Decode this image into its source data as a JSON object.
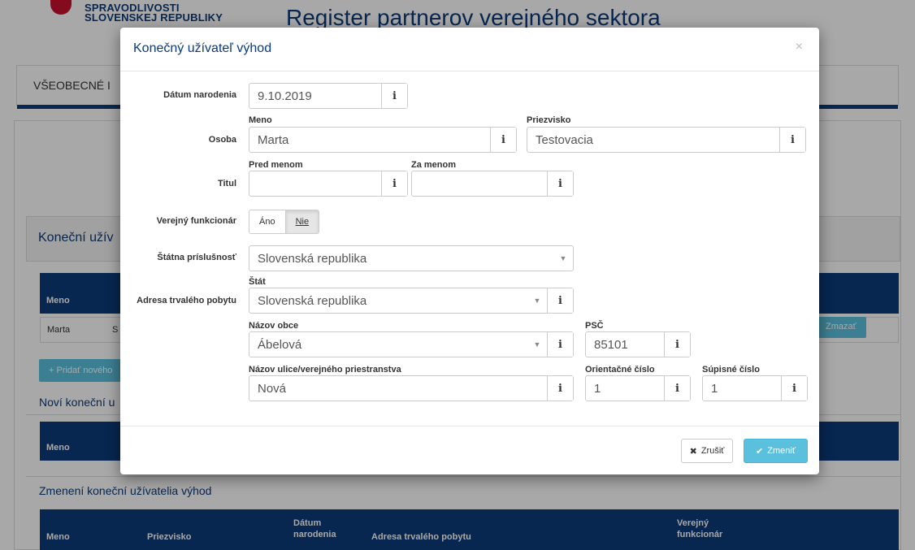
{
  "header": {
    "logo_line1": "SPRAVODLIVOSTI",
    "logo_line2": "SLOVENSKEJ REPUBLIKY",
    "site_title": "Register partnerov verejného sektora"
  },
  "nav": {
    "item": "VŠEOBECNÉ I"
  },
  "background": {
    "panel_title": "Koneční užív",
    "table1": {
      "col_meno": "Meno",
      "row_meno": "Marta",
      "row_second_initial": "S",
      "delete_label": "Zmazať"
    },
    "add_button": "+ Pridať nového",
    "new_section_title": "Noví koneční u",
    "table2": {
      "col_meno": "Meno"
    },
    "changed_section_title": "Zmenení koneční užívatelia výhod",
    "table3": {
      "col_meno": "Meno",
      "col_priezvisko": "Priezvisko",
      "col_datum": "Dátum narodenia",
      "col_adresa": "Adresa trvalého pobytu",
      "col_funkcionar": "Verejný funkcionár"
    }
  },
  "modal": {
    "title": "Konečný užívateľ výhod",
    "close_glyph": "×",
    "info_glyph": "i",
    "labels": {
      "datum": "Dátum narodenia",
      "osoba": "Osoba",
      "titul": "Titul",
      "funkcionar": "Verejný funkcionár",
      "statna": "Štátna príslušnosť",
      "adresa": "Adresa trvalého pobytu"
    },
    "sub_labels": {
      "meno": "Meno",
      "priezvisko": "Priezvisko",
      "pred": "Pred menom",
      "za": "Za menom",
      "stat": "Štát",
      "obec": "Názov obce",
      "psc": "PSČ",
      "ulica": "Názov ulice/verejného priestranstva",
      "orientacne": "Orientačné číslo",
      "supisne": "Súpisné číslo"
    },
    "values": {
      "datum": "9.10.2019",
      "meno": "Marta",
      "priezvisko": "Testovacia",
      "pred": "",
      "za": "",
      "statna": "Slovenská republika",
      "stat": "Slovenská republika",
      "obec": "Ábelová",
      "psc": "85101",
      "ulica": "Nová",
      "orientacne": "1",
      "supisne": "1"
    },
    "toggle": {
      "yes": "Áno",
      "no": "Nie",
      "selected": "Nie"
    },
    "buttons": {
      "cancel": "Zrušiť",
      "ok": "Zmeniť"
    }
  },
  "colors": {
    "brand": "#0c3a7a",
    "accent": "#5bc0de",
    "red": "#c8102e"
  }
}
